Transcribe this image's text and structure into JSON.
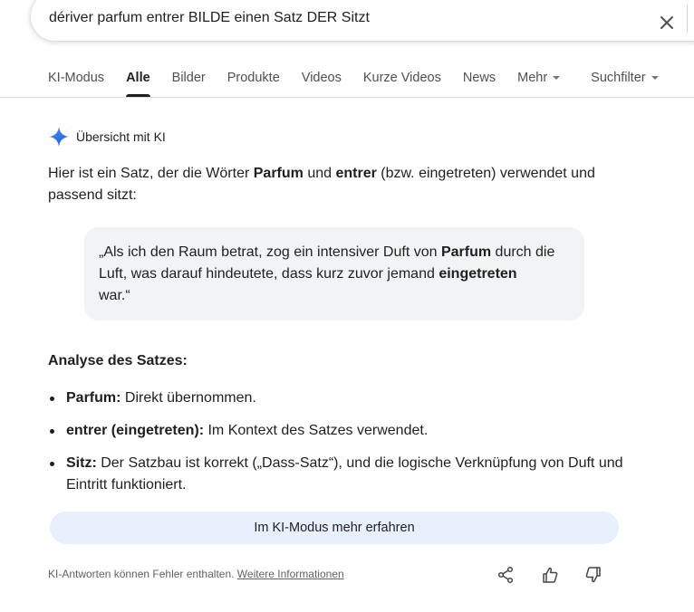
{
  "search": {
    "query": "dériver parfum entrer BILDE einen Satz DER Sitzt",
    "clear_icon": "close-icon"
  },
  "tabs": [
    {
      "label": "KI-Modus"
    },
    {
      "label": "Alle",
      "active": true
    },
    {
      "label": "Bilder"
    },
    {
      "label": "Produkte"
    },
    {
      "label": "Videos"
    },
    {
      "label": "Kurze Videos"
    },
    {
      "label": "News"
    },
    {
      "label": "Mehr",
      "dropdown": true
    },
    {
      "label": "Suchfilter",
      "dropdown": true
    }
  ],
  "ai_overview": {
    "header": "Übersicht mit KI",
    "intro": {
      "p1": "Hier ist ein Satz, der die Wörter ",
      "b1": "Parfum",
      "p2": " und ",
      "b2": "entrer",
      "p3": " (bzw. eingetreten) verwendet und passend sitzt:"
    },
    "quote": {
      "line1_a": "„Als ich den Raum betrat, zog ein intensiver Duft von ",
      "line1_b": "Parfum",
      "line1_c": " durch die",
      "line2_a": "Luft, was darauf hindeutete, dass kurz zuvor jemand ",
      "line2_b": "eingetreten",
      "line3": "war.“"
    },
    "analysis_title": "Analyse des Satzes:",
    "bullets": [
      {
        "term": "Parfum:",
        "text": " Direkt übernommen."
      },
      {
        "term": "entrer (eingetreten):",
        "text": " Im Kontext des Satzes verwendet."
      },
      {
        "term": "Sitz:",
        "text": " Der Satzbau ist korrekt („Dass-Satz“), und die logische Verknüpfung von Duft und Eintritt funktioniert."
      }
    ],
    "more_button": "Im KI-Modus mehr erfahren",
    "footer": {
      "note": "KI-Antworten können Fehler enthalten. ",
      "link": "Weitere Informationen"
    }
  },
  "colors": {
    "accent": "#1a73e8",
    "button_bg": "#e8f0fe",
    "quote_bg": "#f1f3f4"
  },
  "icons": [
    "sparkle-icon",
    "share-icon",
    "thumbs-up-icon",
    "thumbs-down-icon"
  ]
}
